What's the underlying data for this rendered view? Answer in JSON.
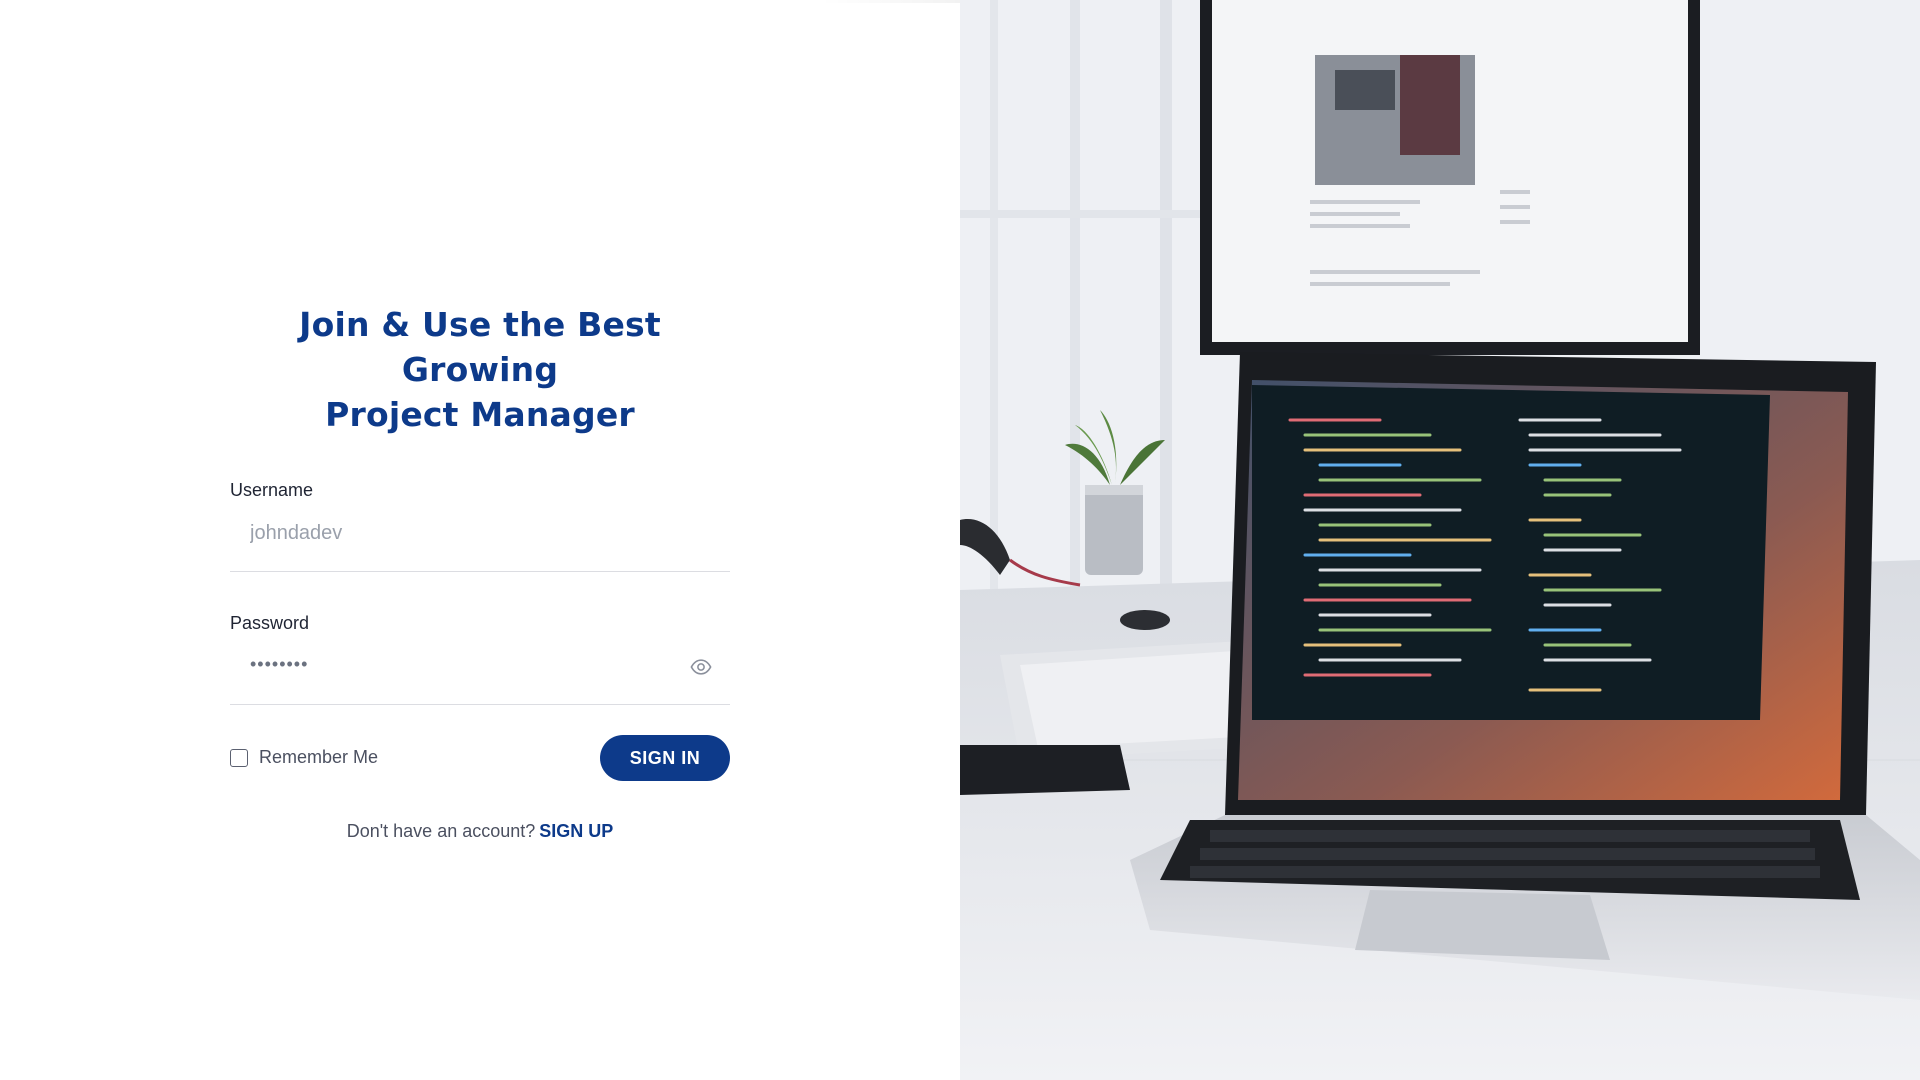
{
  "login": {
    "title_line1": "Join & Use the Best Growing",
    "title_line2": "Project Manager",
    "username": {
      "label": "Username",
      "placeholder": "johndadev"
    },
    "password": {
      "label": "Password",
      "masked_value": "••••••••"
    },
    "remember_label": "Remember Me",
    "signin_label": "SIGN IN",
    "signup_prompt": "Don't have an account?",
    "signup_label": "SIGN UP"
  },
  "icons": {
    "password_toggle": "eye-icon",
    "remember_checkbox": "checkbox-icon"
  },
  "colors": {
    "brand": "#0d3a8a",
    "text": "#1f2433",
    "muted": "#4b5060",
    "placeholder": "#9aa0ab",
    "divider": "#dcdde2"
  },
  "hero_image": {
    "subject": "laptop-and-monitor-workspace-photo"
  }
}
